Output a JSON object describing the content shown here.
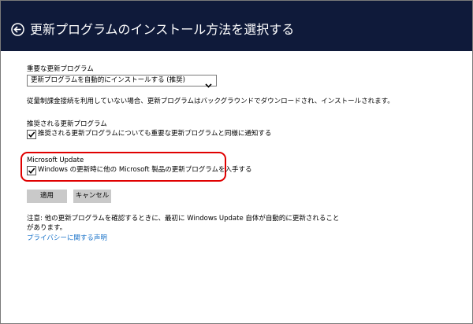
{
  "header": {
    "title": "更新プログラムのインストール方法を選択する",
    "back_icon": "back-arrow-icon"
  },
  "important_updates": {
    "label": "重要な更新プログラム",
    "selected_option": "更新プログラムを自動的にインストールする (推奨)",
    "description": "従量制課金接続を利用していない場合、更新プログラムはバックグラウンドでダウンロードされ、インストールされます。"
  },
  "recommended_updates": {
    "label": "推奨される更新プログラム",
    "checkbox_label": "推奨される更新プログラムについても重要な更新プログラムと同様に通知する",
    "checked": true
  },
  "microsoft_update": {
    "label": "Microsoft Update",
    "checkbox_label": "Windows の更新時に他の Microsoft 製品の更新プログラムを入手する",
    "checked": true
  },
  "buttons": {
    "apply": "適用",
    "cancel": "キャンセル"
  },
  "note": {
    "line1": "注意: 他の更新プログラムを確認するときに、最初に Windows Update 自体が自動的に更新されること",
    "line2": "があります。",
    "privacy_link": "プライバシーに関する声明"
  },
  "colors": {
    "header_bg": "#0f1a3a",
    "highlight": "#e00000",
    "link": "#1a73c9",
    "button_bg": "#c9c9c9"
  }
}
